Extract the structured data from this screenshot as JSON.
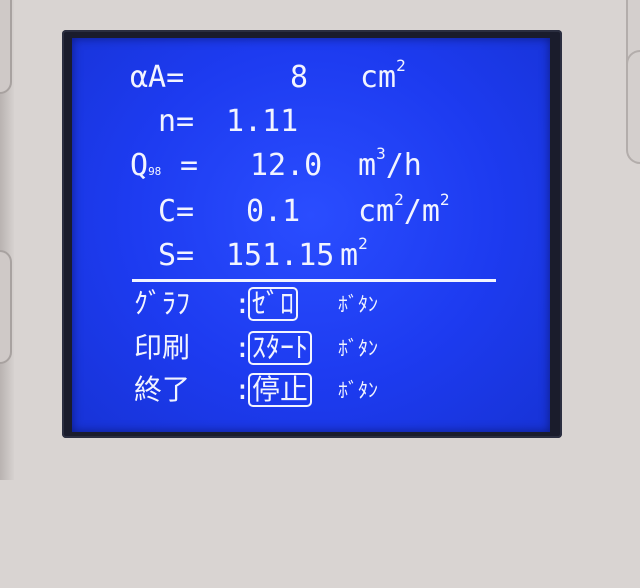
{
  "display": {
    "rows": [
      {
        "label": "αA=",
        "value": "8",
        "unit": "cm",
        "unit_sup": "2",
        "unit_tail": ""
      },
      {
        "label": "n=",
        "value": "1.11",
        "unit": "",
        "unit_sup": "",
        "unit_tail": ""
      },
      {
        "label_main": "Q",
        "label_sub": "98",
        "label_eq": "=",
        "value": "12.0",
        "unit": "m",
        "unit_sup": "3",
        "unit_tail": "/h"
      },
      {
        "label": "C=",
        "value": "0.1",
        "unit": "cm",
        "unit_sup": "2",
        "unit_tail": "/m",
        "unit_tail_sup": "2"
      },
      {
        "label": "S=",
        "value": "151.15",
        "unit": "m",
        "unit_sup": "2",
        "unit_tail": ""
      }
    ],
    "menu": [
      {
        "label": "ｸﾞﾗﾌ",
        "sep": ":",
        "key": "ｾﾞﾛ",
        "suffix": "ﾎﾞﾀﾝ"
      },
      {
        "label": "印刷",
        "sep": ":",
        "key": "ｽﾀｰﾄ",
        "suffix": "ﾎﾞﾀﾝ"
      },
      {
        "label": "終了",
        "sep": ":",
        "key": "停止",
        "suffix": "ﾎﾞﾀﾝ"
      }
    ]
  },
  "colors": {
    "screen": "#1d3bf0",
    "text": "#f2f4ff",
    "bezel": "#1a1c2c",
    "housing": "#d9d4d2"
  }
}
